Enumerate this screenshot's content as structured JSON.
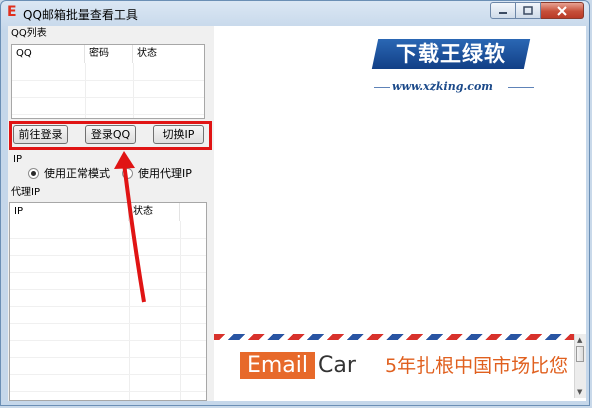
{
  "window": {
    "title": "QQ邮箱批量查看工具",
    "app_icon_glyph": "E",
    "caption_buttons": [
      "minimize-icon",
      "maximize-icon",
      "close-icon"
    ]
  },
  "qq_list": {
    "group_label": "QQ列表",
    "columns": [
      "QQ",
      "密码",
      "状态"
    ],
    "rows": []
  },
  "buttons": {
    "goto_login": "前往登录",
    "login_qq": "登录QQ",
    "switch_ip": "切换IP"
  },
  "ip_group": {
    "label": "IP",
    "options": [
      {
        "label": "使用正常模式",
        "checked": true
      },
      {
        "label": "使用代理IP",
        "checked": false
      }
    ]
  },
  "proxy_list": {
    "group_label": "代理IP",
    "columns": [
      "IP",
      "状态"
    ],
    "rows": []
  },
  "watermark": {
    "title": "下载王绿软",
    "url": "www.xzking.com"
  },
  "ad": {
    "brand_box": "Email",
    "brand_rest": "Car",
    "slogan": "5年扎根中国市场比您"
  },
  "colors": {
    "highlight": "#e01414",
    "accent_orange": "#e7692a",
    "logo_blue": "#1c4a8a"
  }
}
